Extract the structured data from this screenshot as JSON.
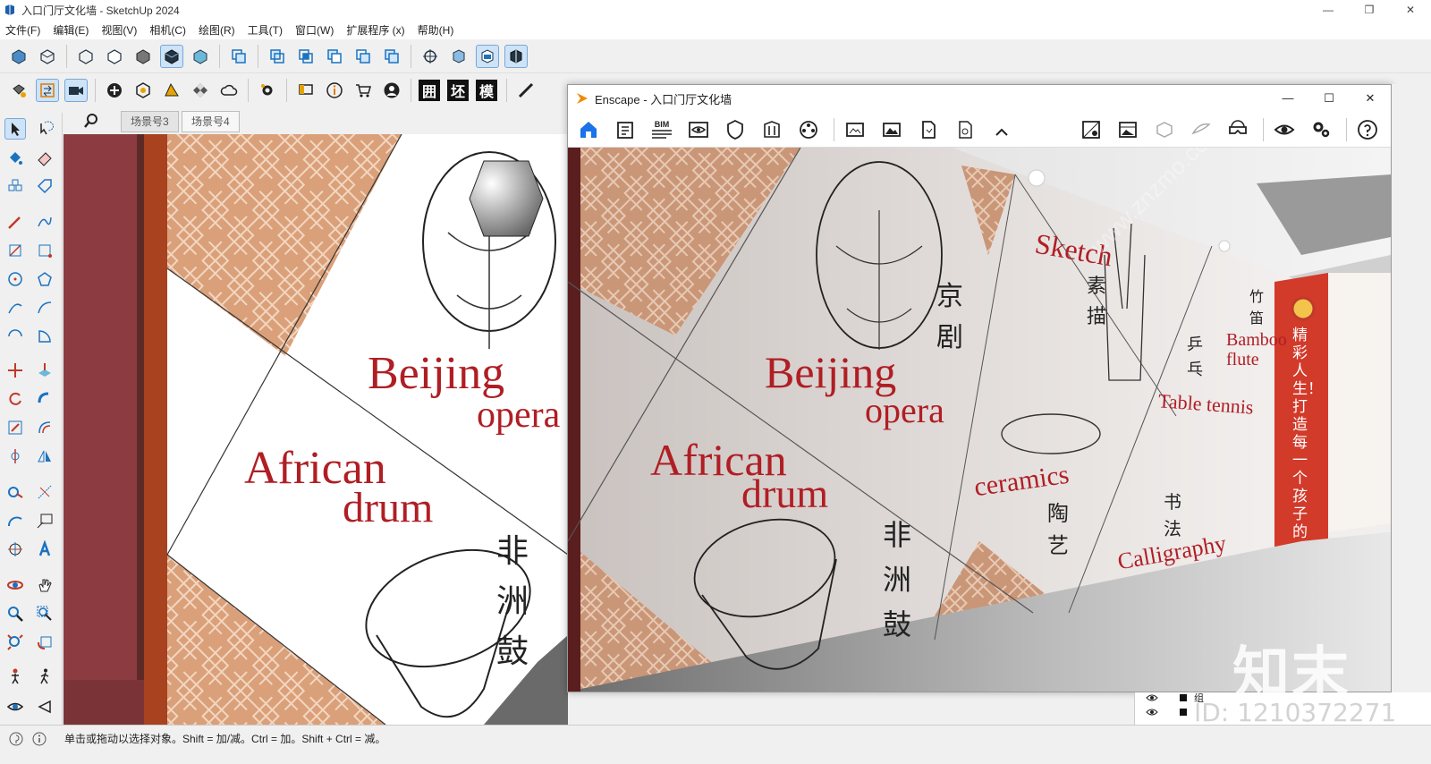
{
  "window": {
    "title": "入口门厅文化墙 - SketchUp 2024",
    "minimize": "—",
    "maximize": "❐",
    "close": "✕"
  },
  "menu": [
    "文件(F)",
    "编辑(E)",
    "视图(V)",
    "相机(C)",
    "绘图(R)",
    "工具(T)",
    "窗口(W)",
    "扩展程序 (x)",
    "帮助(H)"
  ],
  "toolbar2_text_buttons": [
    "囲",
    "坯",
    "模"
  ],
  "scenes": [
    {
      "label": "场景号3",
      "active": false
    },
    {
      "label": "场景号4",
      "active": true
    }
  ],
  "enscape": {
    "title": "Enscape - 入口门厅文化墙",
    "minimize": "—",
    "maximize": "☐",
    "close": "✕",
    "bim_label": "BIM"
  },
  "artwork": {
    "beijing": "Beijing",
    "opera": "opera",
    "african": "African",
    "drum": "drum",
    "drum_cn": [
      "非",
      "洲",
      "鼓"
    ],
    "opera_cn": [
      "京",
      "剧"
    ],
    "sketch": "Sketch",
    "sketch_cn": [
      "素",
      "描"
    ],
    "ceramics": "ceramics",
    "ceramics_cn": [
      "陶",
      "艺"
    ],
    "calligraphy": "Calligraphy",
    "calligraphy_cn": [
      "书",
      "法"
    ],
    "table_tennis": "Table tennis",
    "table_tennis_cn": [
      "乒",
      "乓"
    ],
    "bamboo": "Bamboo",
    "flute": "flute",
    "bamboo_cn": [
      "竹",
      "笛"
    ],
    "slogan_cn": "精彩人生！打造每一个孩子的"
  },
  "layers_panel": {
    "row1": "组"
  },
  "status": {
    "hint": "单击或拖动以选择对象。Shift = 加/减。Ctrl = 加。Shift + Ctrl = 减。"
  },
  "watermark": {
    "logo": "知末",
    "id": "ID: 1210372271",
    "site": "www.znzmo.com"
  },
  "colors": {
    "accent_red": "#b01e24",
    "wall_orange": "#d9a07a",
    "toolbar_active": "#cde3f7",
    "enscape_blue": "#1a73e8"
  }
}
